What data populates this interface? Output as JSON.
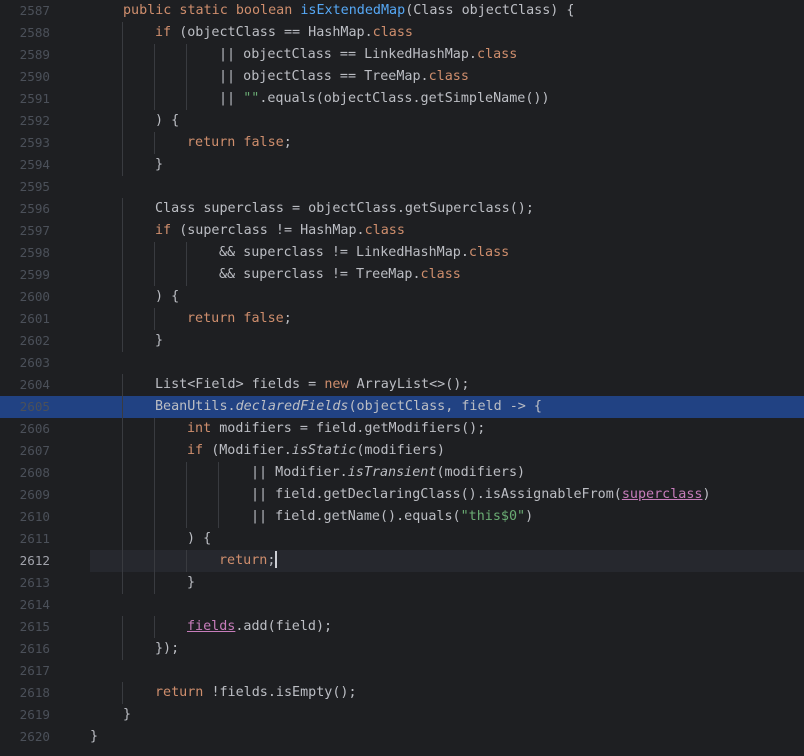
{
  "editor": {
    "current_line": 2612,
    "selected_line": 2605,
    "colors": {
      "background": "#1e1f22",
      "keyword": "#cf8e6d",
      "function": "#56a8f5",
      "string": "#6aab73",
      "text": "#bcbec4",
      "line_number": "#4b5059",
      "selection": "#214283"
    },
    "lines": [
      {
        "n": "2587",
        "indent": 1,
        "tokens": [
          [
            "kw",
            "public static boolean "
          ],
          [
            "fn",
            "isExtendedMap"
          ],
          [
            "p",
            "(Class objectClass) {"
          ]
        ]
      },
      {
        "n": "2588",
        "indent": 2,
        "tokens": [
          [
            "kw",
            "if "
          ],
          [
            "p",
            "(objectClass == HashMap."
          ],
          [
            "kw",
            "class"
          ]
        ]
      },
      {
        "n": "2589",
        "indent": 4,
        "tokens": [
          [
            "p",
            "|| objectClass == LinkedHashMap."
          ],
          [
            "kw",
            "class"
          ]
        ]
      },
      {
        "n": "2590",
        "indent": 4,
        "tokens": [
          [
            "p",
            "|| objectClass == TreeMap."
          ],
          [
            "kw",
            "class"
          ]
        ]
      },
      {
        "n": "2591",
        "indent": 4,
        "tokens": [
          [
            "p",
            "|| "
          ],
          [
            "str",
            "\"\""
          ],
          [
            "p",
            ".equals(objectClass.getSimpleName())"
          ]
        ]
      },
      {
        "n": "2592",
        "indent": 2,
        "tokens": [
          [
            "p",
            ") {"
          ]
        ]
      },
      {
        "n": "2593",
        "indent": 3,
        "tokens": [
          [
            "kw",
            "return false"
          ],
          [
            "p",
            ";"
          ]
        ]
      },
      {
        "n": "2594",
        "indent": 2,
        "tokens": [
          [
            "p",
            "}"
          ]
        ]
      },
      {
        "n": "2595",
        "indent": 0,
        "tokens": []
      },
      {
        "n": "2596",
        "indent": 2,
        "tokens": [
          [
            "p",
            "Class superclass = objectClass.getSuperclass();"
          ]
        ]
      },
      {
        "n": "2597",
        "indent": 2,
        "tokens": [
          [
            "kw",
            "if "
          ],
          [
            "p",
            "(superclass != HashMap."
          ],
          [
            "kw",
            "class"
          ]
        ]
      },
      {
        "n": "2598",
        "indent": 4,
        "tokens": [
          [
            "p",
            "&& superclass != LinkedHashMap."
          ],
          [
            "kw",
            "class"
          ]
        ]
      },
      {
        "n": "2599",
        "indent": 4,
        "tokens": [
          [
            "p",
            "&& superclass != TreeMap."
          ],
          [
            "kw",
            "class"
          ]
        ]
      },
      {
        "n": "2600",
        "indent": 2,
        "tokens": [
          [
            "p",
            ") {"
          ]
        ]
      },
      {
        "n": "2601",
        "indent": 3,
        "tokens": [
          [
            "kw",
            "return false"
          ],
          [
            "p",
            ";"
          ]
        ]
      },
      {
        "n": "2602",
        "indent": 2,
        "tokens": [
          [
            "p",
            "}"
          ]
        ]
      },
      {
        "n": "2603",
        "indent": 0,
        "tokens": []
      },
      {
        "n": "2604",
        "indent": 2,
        "tokens": [
          [
            "p",
            "List<Field> fields = "
          ],
          [
            "kw",
            "new "
          ],
          [
            "p",
            "ArrayList<>();"
          ]
        ]
      },
      {
        "n": "2605",
        "indent": 2,
        "tokens": [
          [
            "p",
            "BeanUtils."
          ],
          [
            "it",
            "declaredFields"
          ],
          [
            "p",
            "(objectClass, field -> {"
          ]
        ]
      },
      {
        "n": "2606",
        "indent": 3,
        "tokens": [
          [
            "kw",
            "int "
          ],
          [
            "p",
            "modifiers = field.getModifiers();"
          ]
        ]
      },
      {
        "n": "2607",
        "indent": 3,
        "tokens": [
          [
            "kw",
            "if "
          ],
          [
            "p",
            "(Modifier."
          ],
          [
            "it",
            "isStatic"
          ],
          [
            "p",
            "(modifiers)"
          ]
        ]
      },
      {
        "n": "2608",
        "indent": 5,
        "tokens": [
          [
            "p",
            "|| Modifier."
          ],
          [
            "it",
            "isTransient"
          ],
          [
            "p",
            "(modifiers)"
          ]
        ]
      },
      {
        "n": "2609",
        "indent": 5,
        "tokens": [
          [
            "p",
            "|| field.getDeclaringClass().isAssignableFrom("
          ],
          [
            "ul",
            "superclass"
          ],
          [
            "p",
            ")"
          ]
        ]
      },
      {
        "n": "2610",
        "indent": 5,
        "tokens": [
          [
            "p",
            "|| field.getName().equals("
          ],
          [
            "str",
            "\"this$0\""
          ],
          [
            "p",
            ")"
          ]
        ]
      },
      {
        "n": "2611",
        "indent": 3,
        "tokens": [
          [
            "p",
            ") {"
          ]
        ]
      },
      {
        "n": "2612",
        "indent": 4,
        "tokens": [
          [
            "kw",
            "return"
          ],
          [
            "p",
            ";"
          ]
        ]
      },
      {
        "n": "2613",
        "indent": 3,
        "tokens": [
          [
            "p",
            "}"
          ]
        ]
      },
      {
        "n": "2614",
        "indent": 0,
        "tokens": []
      },
      {
        "n": "2615",
        "indent": 3,
        "tokens": [
          [
            "ul",
            "fields"
          ],
          [
            "p",
            ".add(field);"
          ]
        ]
      },
      {
        "n": "2616",
        "indent": 2,
        "tokens": [
          [
            "p",
            "});"
          ]
        ]
      },
      {
        "n": "2617",
        "indent": 0,
        "tokens": []
      },
      {
        "n": "2618",
        "indent": 2,
        "tokens": [
          [
            "kw",
            "return "
          ],
          [
            "p",
            "!fields.isEmpty();"
          ]
        ]
      },
      {
        "n": "2619",
        "indent": 1,
        "tokens": [
          [
            "p",
            "}"
          ]
        ]
      },
      {
        "n": "2620",
        "indent": 0,
        "tokens": [
          [
            "p",
            "}"
          ]
        ]
      }
    ]
  }
}
